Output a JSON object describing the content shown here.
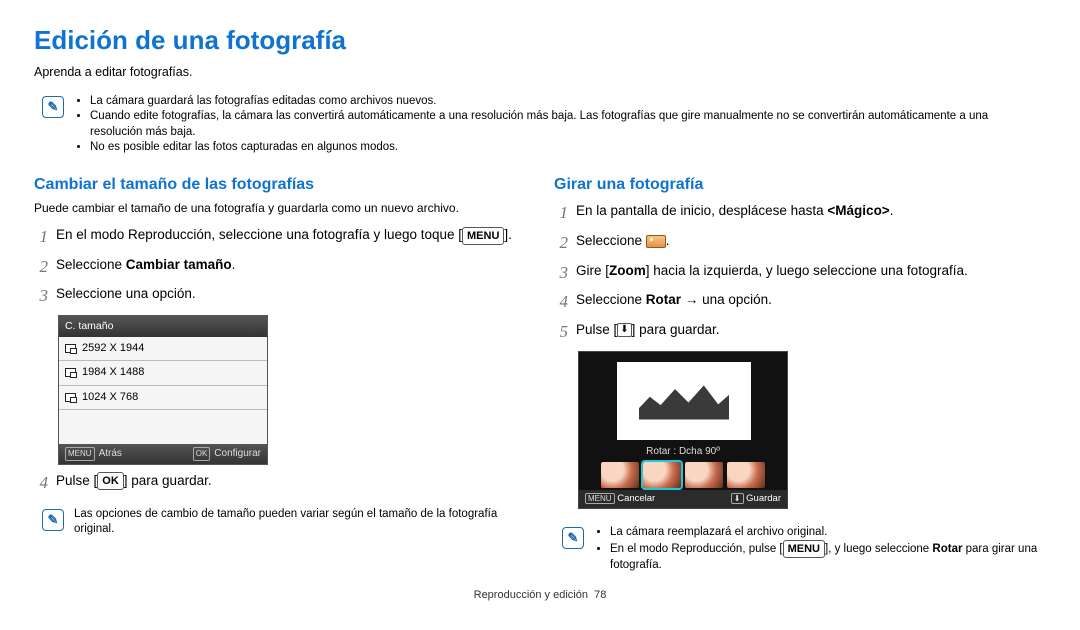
{
  "title": "Edición de una fotografía",
  "intro": "Aprenda a editar fotografías.",
  "top_notes": [
    "La cámara guardará las fotografías editadas como archivos nuevos.",
    "Cuando edite fotografías, la cámara las convertirá automáticamente a una resolución más baja. Las fotografías que gire manualmente no se convertirán automáticamente a una resolución más baja.",
    "No es posible editar las fotos capturadas en algunos modos."
  ],
  "left": {
    "heading": "Cambiar el tamaño de las fotografías",
    "desc": "Puede cambiar el tamaño de una fotografía y guardarla como un nuevo archivo.",
    "step1_a": "En el modo Reproducción, seleccione una fotografía y luego toque [",
    "step1_b": "].",
    "step2_a": "Seleccione ",
    "step2_bold": "Cambiar tamaño",
    "step2_b": ".",
    "step3": "Seleccione una opción.",
    "screen": {
      "header": "C. tamaño",
      "opts": [
        "2592 X 1944",
        "1984 X 1488",
        "1024 X 768"
      ],
      "footer_left": "Atrás",
      "footer_right": "Configurar"
    },
    "step4_a": "Pulse [",
    "step4_b": "] para guardar.",
    "note": "Las opciones de cambio de tamaño pueden variar según el tamaño de la fotografía original."
  },
  "right": {
    "heading": "Girar una fotografía",
    "step1_a": "En la pantalla de inicio, desplácese hasta ",
    "step1_bold": "<Mágico>",
    "step1_b": ".",
    "step2": "Seleccione ",
    "step2_b": ".",
    "step3_a": "Gire [",
    "step3_bold": "Zoom",
    "step3_b": "] hacia la izquierda, y luego seleccione una fotografía.",
    "step4_a": "Seleccione ",
    "step4_bold": "Rotar",
    "step4_b": " → una opción.",
    "step5_a": "Pulse [",
    "step5_b": "] para guardar.",
    "screen": {
      "label": "Rotar : Dcha 90º",
      "footer_left": "Cancelar",
      "footer_right": "Guardar"
    },
    "notes": [
      "La cámara reemplazará el archivo original.",
      "En el modo Reproducción, pulse [MENU], y luego seleccione Rotar para girar una fotografía."
    ],
    "note2_a": "En el modo Reproducción, pulse [",
    "note2_b": "], y luego seleccione ",
    "note2_bold": "Rotar",
    "note2_c": " para girar una fotografía."
  },
  "menu_label": "MENU",
  "ok_label": "OK",
  "footer_section": "Reproducción y edición",
  "footer_page": "78"
}
